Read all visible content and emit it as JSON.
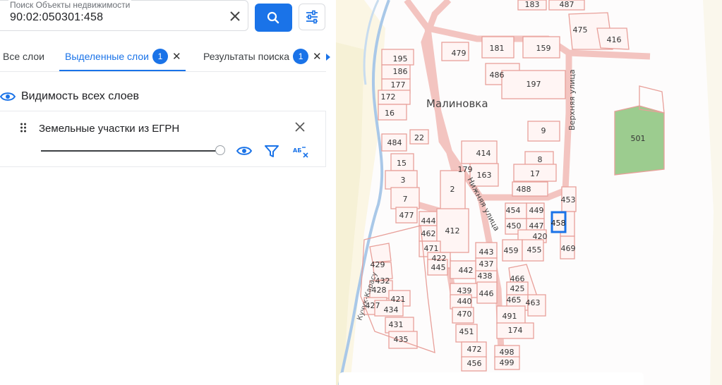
{
  "search": {
    "label": "Поиск Объекты недвижимости",
    "value": "90:02:050301:458"
  },
  "tabs": [
    {
      "label": "Все слои"
    },
    {
      "label": "Выделенные слои",
      "badge": "1"
    },
    {
      "label": "Результаты поиска",
      "badge": "1"
    }
  ],
  "visibility": {
    "label": "Видимость всех слоев"
  },
  "layer": {
    "name": "Земельные участки из ЕГРН",
    "opacity_percent": 100
  },
  "map": {
    "village_name": "Малиновка",
    "streets": [
      "Нижняя улица",
      "Верхняя улица"
    ],
    "river": "Кучук-Карасу",
    "selected_parcel": "458",
    "colors": {
      "accent": "#1a73e8",
      "parcel_stroke": "#e8a09a",
      "road": "#f3c4c0",
      "green_area": "#9ccc8f",
      "river": "#a9c8e8"
    },
    "parcels": [
      "487",
      "183",
      "475",
      "416",
      "479",
      "181",
      "159",
      "195",
      "186",
      "486",
      "177",
      "197",
      "172",
      "16",
      "484",
      "22",
      "9",
      "414",
      "8",
      "15",
      "179",
      "163",
      "17",
      "3",
      "2",
      "488",
      "7",
      "477",
      "444",
      "454",
      "449",
      "453",
      "462",
      "412",
      "450",
      "447",
      "458",
      "420",
      "471",
      "459",
      "455",
      "469",
      "422",
      "443",
      "437",
      "445",
      "442",
      "438",
      "466",
      "429",
      "432",
      "425",
      "428",
      "439",
      "446",
      "421",
      "440",
      "465",
      "463",
      "427",
      "434",
      "470",
      "491",
      "431",
      "451",
      "174",
      "435",
      "472",
      "498",
      "456",
      "499",
      "501"
    ]
  }
}
